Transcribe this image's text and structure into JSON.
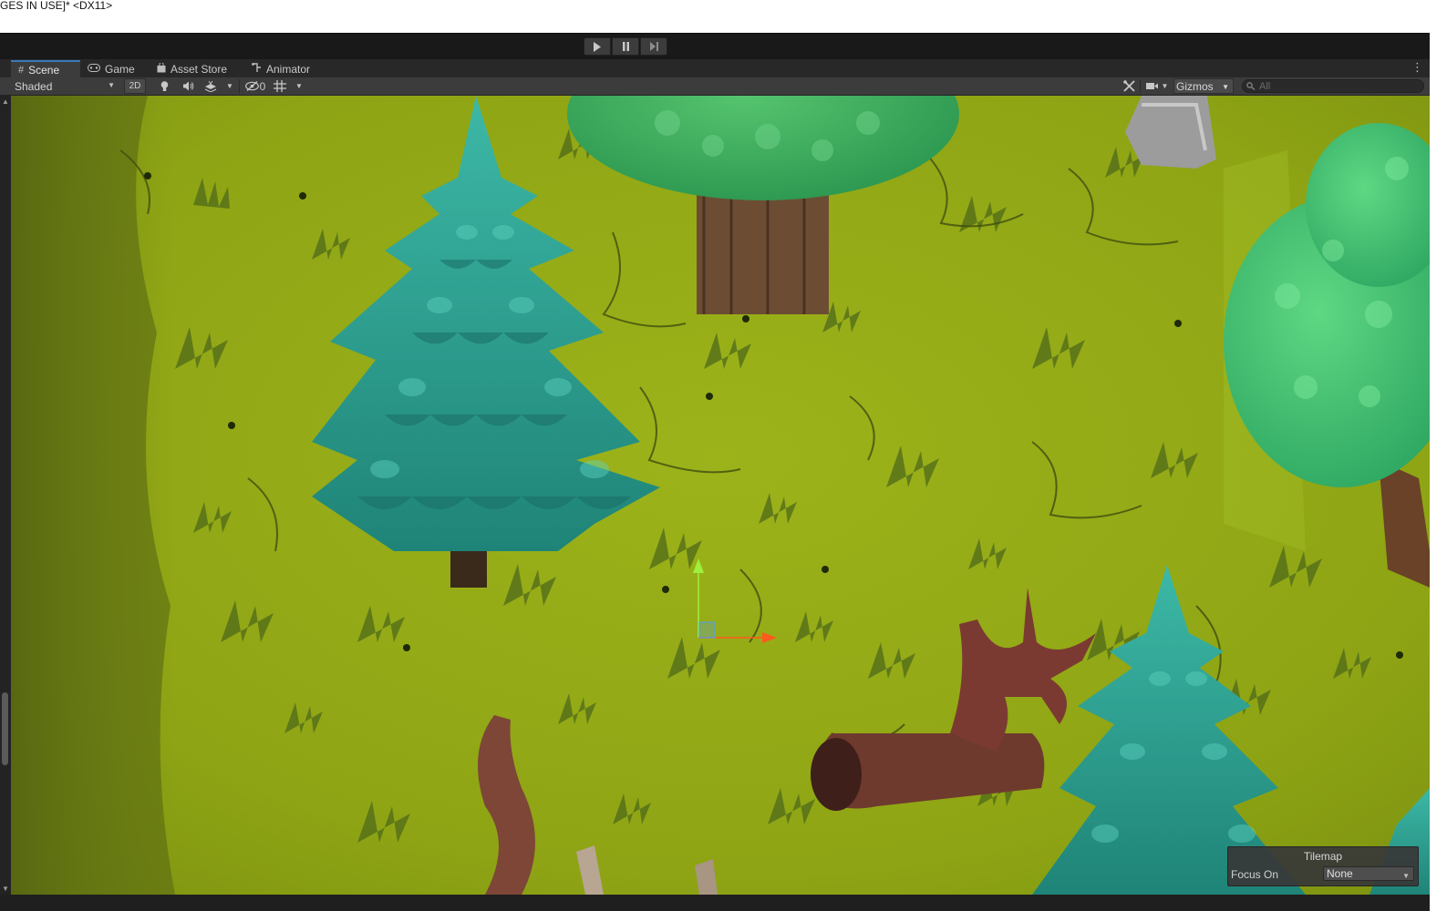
{
  "window": {
    "title_fragment": "GES IN USE]* <DX11>"
  },
  "playbar": {
    "play_icon": "play-icon",
    "pause_icon": "pause-icon",
    "step_icon": "step-icon"
  },
  "tabs": [
    {
      "label": "Scene",
      "icon": "hash-grid-icon",
      "active": true
    },
    {
      "label": "Game",
      "icon": "gamepad-icon",
      "active": false
    },
    {
      "label": "Asset Store",
      "icon": "shopping-bag-icon",
      "active": false
    },
    {
      "label": "Animator",
      "icon": "animator-icon",
      "active": false
    }
  ],
  "scene_toolbar": {
    "draw_mode": "Shaded",
    "mode_2d_label": "2D",
    "hidden_count": "0",
    "gizmos_label": "Gizmos",
    "search_placeholder": "All"
  },
  "overlay": {
    "title": "Tilemap",
    "focus_label": "Focus On",
    "focus_value": "None"
  },
  "colors": {
    "grass": "#8ea414",
    "pine": "#2a9b8e",
    "canopy": "#3fae5a",
    "accent_tab": "#3a79bb",
    "gizmo_x": "#ff5a1e",
    "gizmo_y": "#9ef03c"
  }
}
